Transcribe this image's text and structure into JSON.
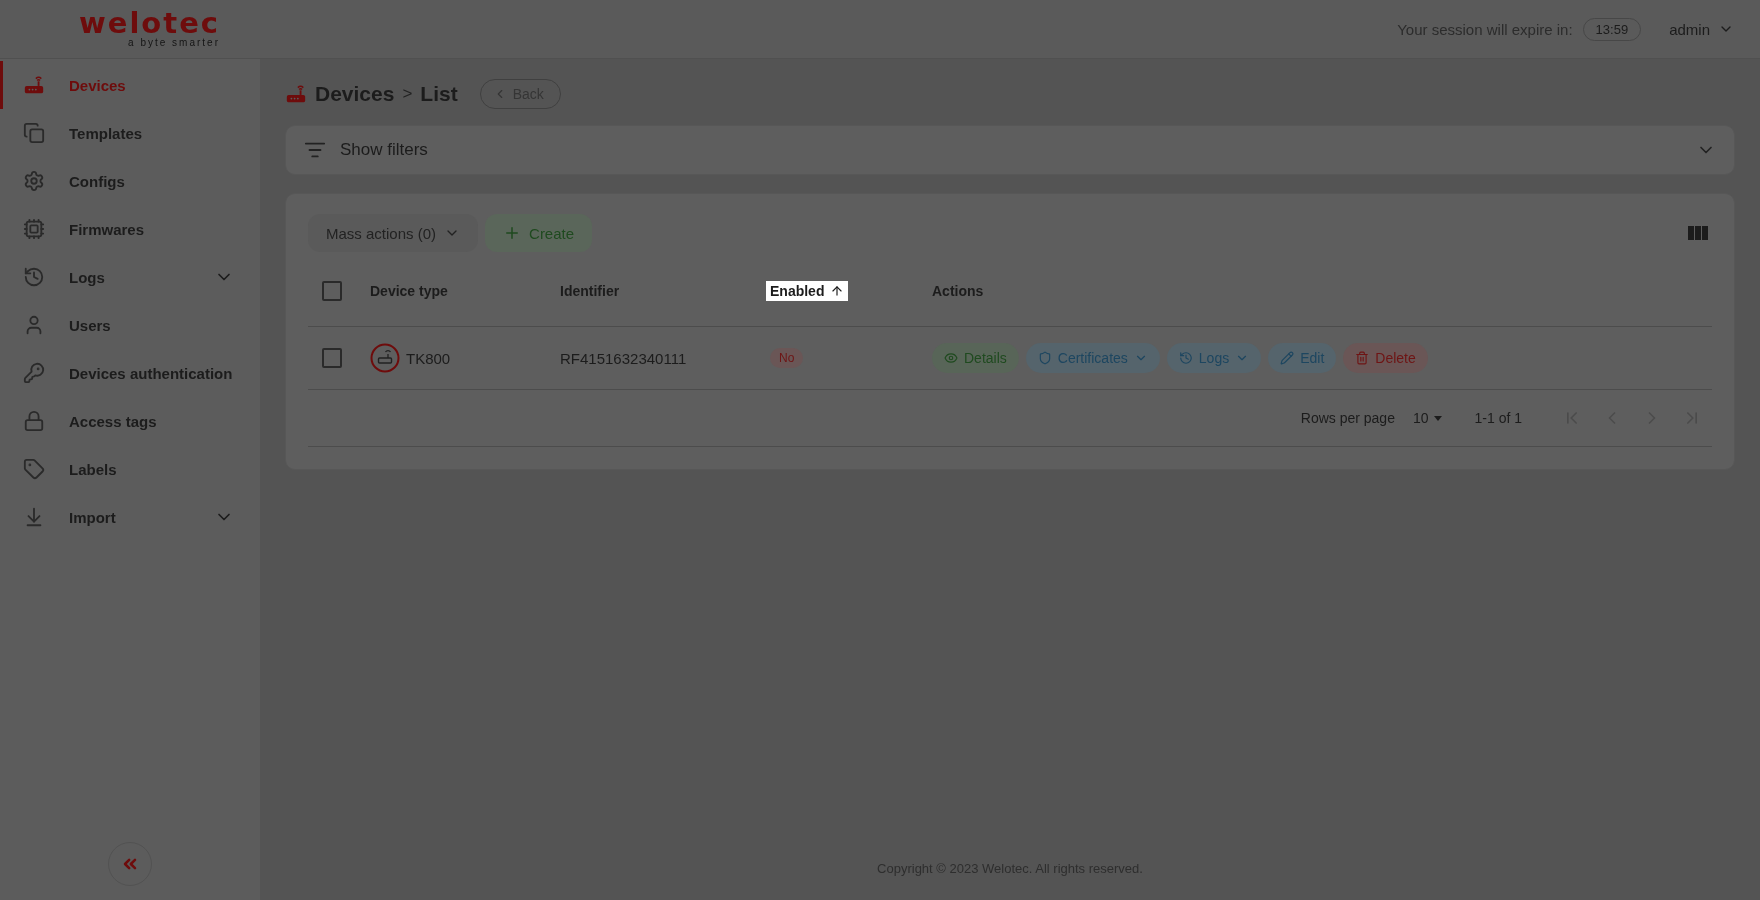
{
  "header": {
    "logo": "welotec",
    "tagline": "a byte smarter",
    "session_label": "Your session will expire in:",
    "session_time": "13:59",
    "user": "admin"
  },
  "sidebar": {
    "items": [
      {
        "label": "Devices",
        "selected": true,
        "has_submenu": false
      },
      {
        "label": "Templates",
        "selected": false,
        "has_submenu": false
      },
      {
        "label": "Configs",
        "selected": false,
        "has_submenu": false
      },
      {
        "label": "Firmwares",
        "selected": false,
        "has_submenu": false
      },
      {
        "label": "Logs",
        "selected": false,
        "has_submenu": true
      },
      {
        "label": "Users",
        "selected": false,
        "has_submenu": false
      },
      {
        "label": "Devices authentication",
        "selected": false,
        "has_submenu": false
      },
      {
        "label": "Access tags",
        "selected": false,
        "has_submenu": false
      },
      {
        "label": "Labels",
        "selected": false,
        "has_submenu": false
      },
      {
        "label": "Import",
        "selected": false,
        "has_submenu": true
      }
    ]
  },
  "breadcrumb": {
    "section": "Devices",
    "separator": ">",
    "page": "List",
    "back": "Back"
  },
  "filters": {
    "label": "Show filters",
    "expanded": false
  },
  "toolbar": {
    "mass_actions": {
      "label": "Mass actions (0)",
      "disabled": true
    },
    "create": "Create"
  },
  "table": {
    "columns": [
      {
        "label": "Device type",
        "sorted": false,
        "spotlight": false
      },
      {
        "label": "Identifier",
        "sorted": false,
        "spotlight": false
      },
      {
        "label": "Enabled",
        "sorted": true,
        "spotlight": true
      },
      {
        "label": "Actions",
        "sorted": false,
        "spotlight": false
      }
    ],
    "header_checked": false,
    "rows": [
      {
        "checked": false,
        "device_type": "TK800",
        "identifier": "RF4151632340111",
        "enabled": {
          "label": "No",
          "on": false
        },
        "actions": [
          {
            "label": "Details",
            "kind": "details",
            "dropdown": false
          },
          {
            "label": "Certificates",
            "kind": "certificates",
            "dropdown": true
          },
          {
            "label": "Logs",
            "kind": "logs",
            "dropdown": true
          },
          {
            "label": "Edit",
            "kind": "edit",
            "dropdown": false
          },
          {
            "label": "Delete",
            "kind": "delete",
            "dropdown": false
          }
        ]
      }
    ]
  },
  "pagination": {
    "rows_per_page_label": "Rows per page",
    "rows_per_page": "10",
    "range": "1-1 of 1",
    "buttons": [
      {
        "kind": "first",
        "disabled": true
      },
      {
        "kind": "prev",
        "disabled": true
      },
      {
        "kind": "next",
        "disabled": true
      },
      {
        "kind": "last",
        "disabled": true
      }
    ]
  },
  "footer": "Copyright © 2023 Welotec. All rights reserved."
}
